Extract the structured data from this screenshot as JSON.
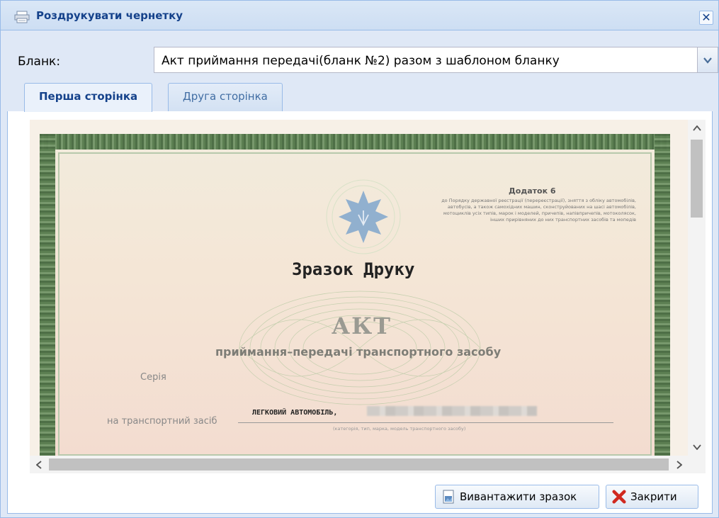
{
  "window": {
    "title": "Роздрукувати чернетку",
    "close_glyph": "✕"
  },
  "form": {
    "blank_label": "Бланк:",
    "blank_value": "Акт приймання передачі(бланк №2) разом з шаблоном бланку"
  },
  "tabs": [
    {
      "label": "Перша сторінка",
      "active": true
    },
    {
      "label": "Друга сторінка",
      "active": false
    }
  ],
  "document": {
    "addendum_title": "Додаток 6",
    "addendum_text": "до Порядку державної реєстрації (перереєстрації), зняття з обліку автомобілів, автобусів, а також самохідних машин, сконструйованих на шасі автомобілів, мотоциклів усіх типів, марок і моделей, причепів, напівпричепів, мотоколясок, інших прирівняних до них транспортних засобів та мопедів",
    "specimen": "Зразок Друку",
    "akt": "АКТ",
    "subtitle": "приймання–передачі транспортного засобу",
    "series_label": "Серія",
    "vehicle_label": "на транспортний засіб",
    "vehicle_value": "ЛЕГКОВИЙ  АВТОМОБІЛЬ,",
    "vehicle_caption": "(категорія, тип, марка, модель транспортного засобу)"
  },
  "buttons": {
    "download": "Вивантажити зразок",
    "close": "Закрити"
  },
  "icons": {
    "title": "printer-icon",
    "combo": "chevron-down-icon",
    "download": "document-icon",
    "close": "red-x-icon"
  },
  "colors": {
    "accent": "#15428b",
    "border": "#99bbe8",
    "panel_bg": "#dfe8f6",
    "close_red": "#d0281f"
  }
}
